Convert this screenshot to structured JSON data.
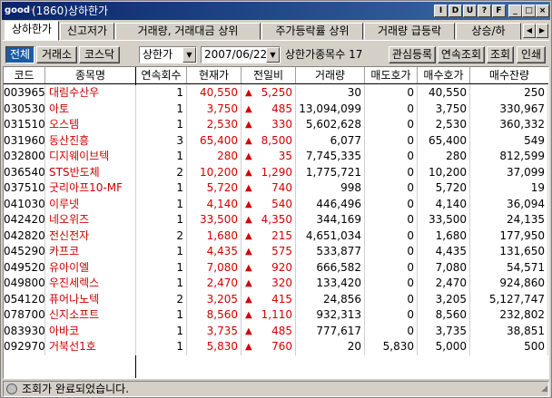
{
  "window": {
    "logo": "good",
    "title": "(1860)상하한가",
    "controls": [
      "I",
      "D",
      "U",
      "?",
      "F",
      "_",
      "□",
      "×"
    ]
  },
  "tabs": [
    {
      "label": "상하한가",
      "active": true
    },
    {
      "label": "신고저가",
      "active": false
    },
    {
      "label": "거래량, 거래대금 상위",
      "active": false
    },
    {
      "label": "주가등락률 상위",
      "active": false
    },
    {
      "label": "거래량 급등락",
      "active": false
    },
    {
      "label": "상승/하",
      "active": false
    }
  ],
  "toolbar": {
    "market_buttons": [
      {
        "label": "전체",
        "pressed": true
      },
      {
        "label": "거래소",
        "pressed": false
      },
      {
        "label": "코스닥",
        "pressed": false
      }
    ],
    "type_select": "상한가",
    "date_select": "2007/06/22",
    "count_label": "상한가종목수",
    "count_value": "17",
    "right_buttons": [
      "관심등록",
      "연속조회",
      "조회",
      "인쇄"
    ]
  },
  "grid": {
    "columns": [
      "코드",
      "종목명",
      "연속회수",
      "현재가",
      "전일비",
      "거래량",
      "매도호가",
      "매수호가",
      "매수잔량"
    ],
    "rows": [
      {
        "code": "003965",
        "name": "대림수산우",
        "streak": "1",
        "price": "40,550",
        "change": "5,250",
        "volume": "30",
        "ask": "0",
        "bid": "40,550",
        "bid_qty": "250"
      },
      {
        "code": "030530",
        "name": "아토",
        "streak": "1",
        "price": "3,750",
        "change": "485",
        "volume": "13,094,099",
        "ask": "0",
        "bid": "3,750",
        "bid_qty": "330,967"
      },
      {
        "code": "031510",
        "name": "오스템",
        "streak": "1",
        "price": "2,530",
        "change": "330",
        "volume": "5,602,628",
        "ask": "0",
        "bid": "2,530",
        "bid_qty": "360,332"
      },
      {
        "code": "031960",
        "name": "동산진흥",
        "streak": "3",
        "price": "65,400",
        "change": "8,500",
        "volume": "6,077",
        "ask": "0",
        "bid": "65,400",
        "bid_qty": "549"
      },
      {
        "code": "032800",
        "name": "디지웨이브텍",
        "streak": "1",
        "price": "280",
        "change": "35",
        "volume": "7,745,335",
        "ask": "0",
        "bid": "280",
        "bid_qty": "812,599"
      },
      {
        "code": "036540",
        "name": "STS반도체",
        "streak": "2",
        "price": "10,200",
        "change": "1,290",
        "volume": "1,775,721",
        "ask": "0",
        "bid": "10,200",
        "bid_qty": "37,099"
      },
      {
        "code": "037510",
        "name": "굿리아프10-MF",
        "streak": "1",
        "price": "5,720",
        "change": "740",
        "volume": "998",
        "ask": "0",
        "bid": "5,720",
        "bid_qty": "19"
      },
      {
        "code": "041030",
        "name": "이루넷",
        "streak": "1",
        "price": "4,140",
        "change": "540",
        "volume": "446,496",
        "ask": "0",
        "bid": "4,140",
        "bid_qty": "36,094"
      },
      {
        "code": "042420",
        "name": "네오위즈",
        "streak": "1",
        "price": "33,500",
        "change": "4,350",
        "volume": "344,169",
        "ask": "0",
        "bid": "33,500",
        "bid_qty": "24,135"
      },
      {
        "code": "042820",
        "name": "전신전자",
        "streak": "2",
        "price": "1,680",
        "change": "215",
        "volume": "4,651,034",
        "ask": "0",
        "bid": "1,680",
        "bid_qty": "177,950"
      },
      {
        "code": "045290",
        "name": "카프코",
        "streak": "1",
        "price": "4,435",
        "change": "575",
        "volume": "533,877",
        "ask": "0",
        "bid": "4,435",
        "bid_qty": "131,650"
      },
      {
        "code": "049520",
        "name": "유아이엘",
        "streak": "1",
        "price": "7,080",
        "change": "920",
        "volume": "666,582",
        "ask": "0",
        "bid": "7,080",
        "bid_qty": "54,571"
      },
      {
        "code": "049800",
        "name": "우진세렉스",
        "streak": "1",
        "price": "2,470",
        "change": "320",
        "volume": "133,420",
        "ask": "0",
        "bid": "2,470",
        "bid_qty": "924,860"
      },
      {
        "code": "054120",
        "name": "퓨어나노텍",
        "streak": "2",
        "price": "3,205",
        "change": "415",
        "volume": "24,856",
        "ask": "0",
        "bid": "3,205",
        "bid_qty": "5,127,747"
      },
      {
        "code": "078700",
        "name": "신지소프트",
        "streak": "1",
        "price": "8,560",
        "change": "1,110",
        "volume": "932,313",
        "ask": "0",
        "bid": "8,560",
        "bid_qty": "232,802"
      },
      {
        "code": "083930",
        "name": "아바코",
        "streak": "1",
        "price": "3,735",
        "change": "485",
        "volume": "777,617",
        "ask": "0",
        "bid": "3,735",
        "bid_qty": "38,851"
      },
      {
        "code": "092970",
        "name": "거북선1호",
        "streak": "1",
        "price": "5,830",
        "change": "760",
        "volume": "20",
        "ask": "5,830",
        "bid": "5,000",
        "bid_qty": "500"
      }
    ]
  },
  "status": {
    "text": "조회가 완료되었습니다."
  },
  "colors": {
    "title_bar": "#0a246a",
    "up_red": "#d40000",
    "name_red": "#cc0000",
    "pressed_blue": "#1c5aa8"
  }
}
